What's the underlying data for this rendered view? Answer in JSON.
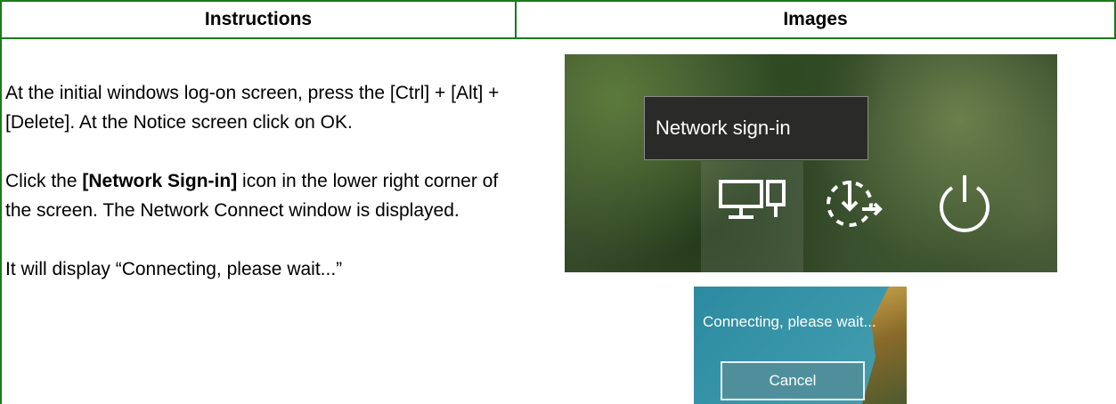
{
  "table": {
    "header_instructions": "Instructions",
    "header_images": "Images"
  },
  "instructions": {
    "p1": "At the initial windows log-on screen, press the [Ctrl] + [Alt] + [Delete]. At the Notice screen click on OK.",
    "p2_prefix": "Click the ",
    "p2_bold": "[Network Sign-in]",
    "p2_suffix": " icon in the lower right corner of the screen. The Network Connect window is displayed.",
    "p3": "It will display “Connecting, please wait...”"
  },
  "screenshot1": {
    "tooltip": "Network sign-in",
    "icons": [
      "network-sign-in-icon",
      "accessibility-icon",
      "power-icon"
    ]
  },
  "screenshot2": {
    "message": "Connecting, please wait...",
    "cancel_label": "Cancel"
  },
  "colors": {
    "border": "#1a7a1a"
  }
}
